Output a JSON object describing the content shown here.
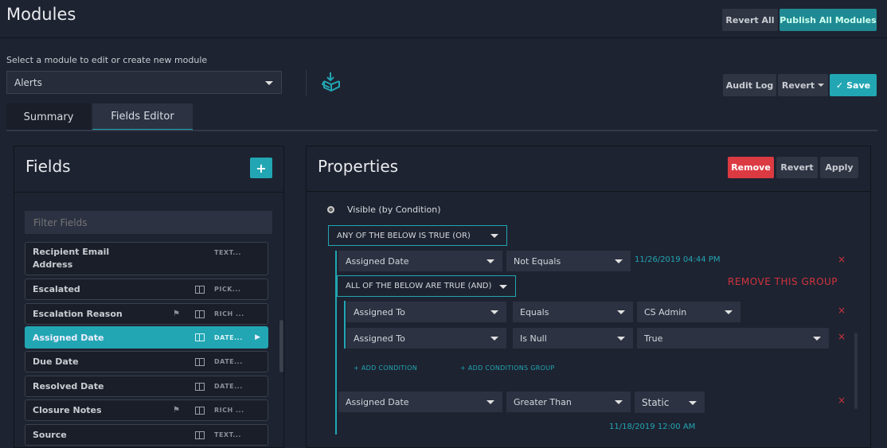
{
  "header": {
    "title": "Modules",
    "revert_all": "Revert All",
    "publish_all": "Publish All Modules"
  },
  "module_select": {
    "label": "Select a module to edit or create new module",
    "value": "Alerts"
  },
  "toolbar": {
    "audit_log": "Audit Log",
    "revert": "Revert",
    "save": "Save"
  },
  "tabs": [
    {
      "label": "Summary"
    },
    {
      "label": "Fields Editor"
    }
  ],
  "fields": {
    "title": "Fields",
    "add": "+",
    "filter_placeholder": "Filter Fields",
    "items": [
      {
        "name": "Recipient Email Address",
        "type": "TEXT...",
        "flag": false,
        "book": false
      },
      {
        "name": "Escalated",
        "type": "PICK...",
        "flag": false,
        "book": true
      },
      {
        "name": "Escalation Reason",
        "type": "RICH ...",
        "flag": true,
        "book": true
      },
      {
        "name": "Assigned Date",
        "type": "DATE...",
        "flag": false,
        "book": true,
        "active": true
      },
      {
        "name": "Due Date",
        "type": "DATE...",
        "flag": false,
        "book": true
      },
      {
        "name": "Resolved Date",
        "type": "DATE...",
        "flag": false,
        "book": true
      },
      {
        "name": "Closure Notes",
        "type": "RICH ...",
        "flag": true,
        "book": true
      },
      {
        "name": "Source",
        "type": "TEXT...",
        "flag": false,
        "book": true
      }
    ]
  },
  "properties": {
    "title": "Properties",
    "remove": "Remove",
    "revert": "Revert",
    "apply": "Apply",
    "visibility": "Visible (by Condition)",
    "or_group": "ANY OF THE BELOW IS TRUE (OR)",
    "cond1": {
      "field": "Assigned Date",
      "op": "Not Equals",
      "value": "11/26/2019 04:44 PM"
    },
    "and_group": "ALL OF THE BELOW ARE TRUE (AND)",
    "remove_group": "REMOVE THIS GROUP",
    "cond2": {
      "field": "Assigned To",
      "op": "Equals",
      "value": "CS Admin"
    },
    "cond3": {
      "field": "Assigned To",
      "op": "Is Null",
      "value": "True"
    },
    "add_condition": "ADD CONDITION",
    "add_group": "ADD CONDITIONS GROUP",
    "cond4": {
      "field": "Assigned Date",
      "op": "Greater Than",
      "value": "Static",
      "date": "11/18/2019 12:00 AM"
    },
    "remove_x": "×"
  }
}
